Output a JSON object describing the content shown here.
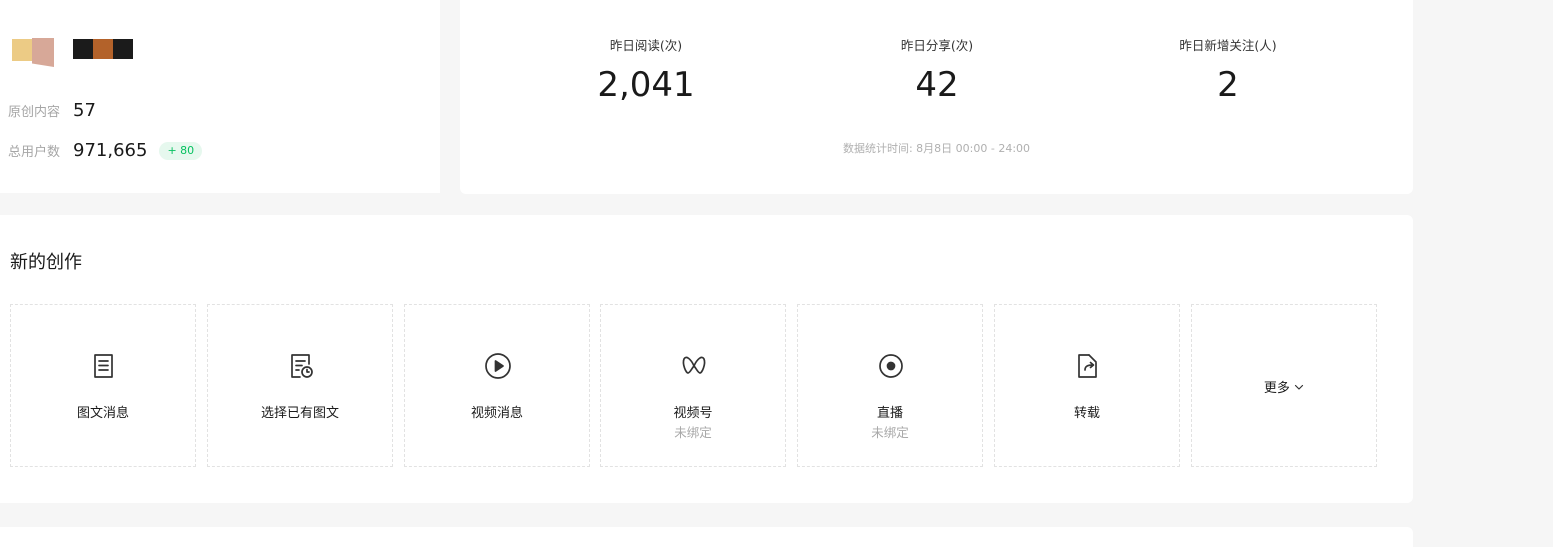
{
  "account": {
    "original_label": "原创内容",
    "original_value": "57",
    "users_label": "总用户数",
    "users_value": "971,665",
    "users_delta": "+ 80"
  },
  "stats": {
    "items": [
      {
        "label": "昨日阅读(次)",
        "value": "2,041"
      },
      {
        "label": "昨日分享(次)",
        "value": "42"
      },
      {
        "label": "昨日新增关注(人)",
        "value": "2"
      }
    ],
    "note": "数据统计时间: 8月8日 00:00 - 24:00"
  },
  "create": {
    "title": "新的创作",
    "tiles": [
      {
        "label": "图文消息",
        "sub": "",
        "icon": "document-icon"
      },
      {
        "label": "选择已有图文",
        "sub": "",
        "icon": "document-clock-icon"
      },
      {
        "label": "视频消息",
        "sub": "",
        "icon": "play-circle-icon"
      },
      {
        "label": "视频号",
        "sub": "未绑定",
        "icon": "channels-icon"
      },
      {
        "label": "直播",
        "sub": "未绑定",
        "icon": "live-icon"
      },
      {
        "label": "转载",
        "sub": "",
        "icon": "share-document-icon"
      }
    ],
    "more_label": "更多"
  },
  "colors": {
    "accent_green": "#07c160",
    "badge_bg": "#e6f8ee",
    "page_bg": "#f6f6f6"
  }
}
